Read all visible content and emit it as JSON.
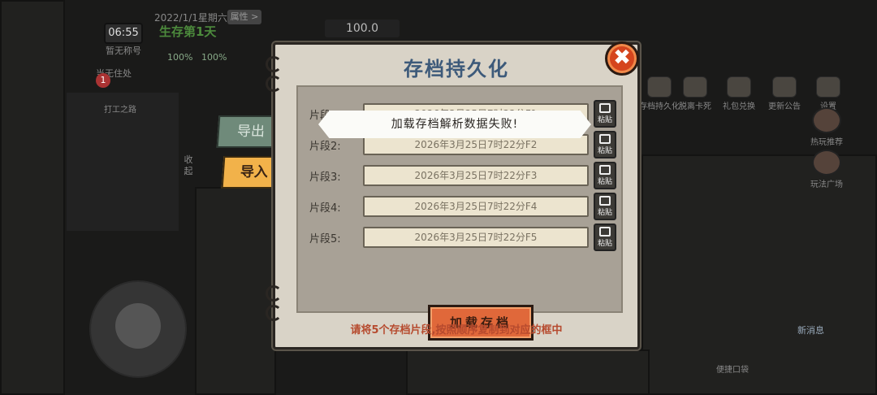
{
  "hud": {
    "date": "2022/1/1星期六",
    "attr_label": "属性 >",
    "time": "06:55",
    "survival_day": "生存第1天",
    "player_title": "暂无称号",
    "stat1": "100%",
    "stat2": "100%",
    "money": "100.0",
    "residence": "当无住处",
    "badge_count": "1",
    "work_label": "打工之路",
    "collapse_label": "收起",
    "right_icons": [
      "存档持久化",
      "脱离卡死",
      "礼包兑换",
      "更新公告",
      "设置"
    ],
    "side_buttons": [
      "热玩推荐",
      "玩法广场"
    ],
    "news_label": "新消息",
    "pocket_label": "便捷口袋"
  },
  "tabs": {
    "export_label": "导出",
    "import_label": "导入"
  },
  "modal": {
    "title": "存档持久化",
    "rows": [
      {
        "label": "片段1:",
        "value": "2026年3月25日7时22分F1"
      },
      {
        "label": "片段2:",
        "value": "2026年3月25日7时22分F2"
      },
      {
        "label": "片段3:",
        "value": "2026年3月25日7时22分F3"
      },
      {
        "label": "片段4:",
        "value": "2026年3月25日7时22分F4"
      },
      {
        "label": "片段5:",
        "value": "2026年3月25日7时22分F5"
      }
    ],
    "paste_label": "粘贴",
    "load_button": "加载存档",
    "hint": "请将5个存档片段,按照顺序复制到对应的框中",
    "close_symbol": "✖"
  },
  "toast": {
    "message": "加载存档解析数据失败!"
  },
  "colors": {
    "title": "#3d5a7a",
    "close": "#d5451e",
    "load_button": "#e0683a",
    "hint": "#b64a2e",
    "import_tab": "#f2b24a",
    "export_tab": "#6f8a7a"
  }
}
